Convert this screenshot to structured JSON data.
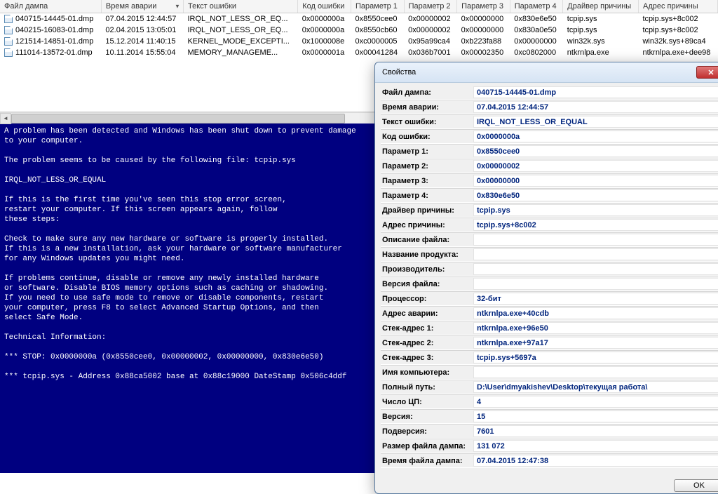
{
  "table": {
    "headers": [
      "Файл дампа",
      "Время аварии",
      "Текст ошибки",
      "Код ошибки",
      "Параметр 1",
      "Параметр 2",
      "Параметр 3",
      "Параметр 4",
      "Драйвер причины",
      "Адрес причины"
    ],
    "sort_col": 1,
    "rows": [
      {
        "file": "040715-14445-01.dmp",
        "time": "07.04.2015 12:44:57",
        "err": "IRQL_NOT_LESS_OR_EQ...",
        "code": "0x0000000a",
        "p1": "0x8550cee0",
        "p2": "0x00000002",
        "p3": "0x00000000",
        "p4": "0x830e6e50",
        "drv": "tcpip.sys",
        "addr": "tcpip.sys+8c002"
      },
      {
        "file": "040215-16083-01.dmp",
        "time": "02.04.2015 13:05:01",
        "err": "IRQL_NOT_LESS_OR_EQ...",
        "code": "0x0000000a",
        "p1": "0x8550cb60",
        "p2": "0x00000002",
        "p3": "0x00000000",
        "p4": "0x830a0e50",
        "drv": "tcpip.sys",
        "addr": "tcpip.sys+8c002"
      },
      {
        "file": "121514-14851-01.dmp",
        "time": "15.12.2014 11:40:15",
        "err": "KERNEL_MODE_EXCEPTI...",
        "code": "0x1000008e",
        "p1": "0xc0000005",
        "p2": "0x95a99ca4",
        "p3": "0xb223fa88",
        "p4": "0x00000000",
        "drv": "win32k.sys",
        "addr": "win32k.sys+89ca4"
      },
      {
        "file": "111014-13572-01.dmp",
        "time": "10.11.2014 15:55:04",
        "err": "MEMORY_MANAGEME...",
        "code": "0x0000001a",
        "p1": "0x00041284",
        "p2": "0x036b7001",
        "p3": "0x00002350",
        "p4": "0xc0802000",
        "drv": "ntkrnlpa.exe",
        "addr": "ntkrnlpa.exe+dee98"
      }
    ]
  },
  "bsod": "A problem has been detected and Windows has been shut down to prevent damage\nto your computer.\n\nThe problem seems to be caused by the following file: tcpip.sys\n\nIRQL_NOT_LESS_OR_EQUAL\n\nIf this is the first time you've seen this stop error screen,\nrestart your computer. If this screen appears again, follow\nthese steps:\n\nCheck to make sure any new hardware or software is properly installed.\nIf this is a new installation, ask your hardware or software manufacturer\nfor any Windows updates you might need.\n\nIf problems continue, disable or remove any newly installed hardware\nor software. Disable BIOS memory options such as caching or shadowing.\nIf you need to use safe mode to remove or disable components, restart\nyour computer, press F8 to select Advanced Startup Options, and then\nselect Safe Mode.\n\nTechnical Information:\n\n*** STOP: 0x0000000a (0x8550cee0, 0x00000002, 0x00000000, 0x830e6e50)\n\n*** tcpip.sys - Address 0x88ca5002 base at 0x88c19000 DateStamp 0x506c4ddf",
  "dialog": {
    "title": "Свойства",
    "rows": [
      {
        "label": "Файл дампа:",
        "value": "040715-14445-01.dmp"
      },
      {
        "label": "Время аварии:",
        "value": "07.04.2015 12:44:57"
      },
      {
        "label": "Текст ошибки:",
        "value": "IRQL_NOT_LESS_OR_EQUAL"
      },
      {
        "label": "Код ошибки:",
        "value": "0x0000000a"
      },
      {
        "label": "Параметр 1:",
        "value": "0x8550cee0"
      },
      {
        "label": "Параметр 2:",
        "value": "0x00000002"
      },
      {
        "label": "Параметр 3:",
        "value": "0x00000000"
      },
      {
        "label": "Параметр 4:",
        "value": "0x830e6e50"
      },
      {
        "label": "Драйвер причины:",
        "value": "tcpip.sys"
      },
      {
        "label": "Адрес причины:",
        "value": "tcpip.sys+8c002"
      },
      {
        "label": "Описание файла:",
        "value": ""
      },
      {
        "label": "Название продукта:",
        "value": ""
      },
      {
        "label": "Производитель:",
        "value": ""
      },
      {
        "label": "Версия файла:",
        "value": ""
      },
      {
        "label": "Процессор:",
        "value": "32-бит"
      },
      {
        "label": "Адрес аварии:",
        "value": "ntkrnlpa.exe+40cdb"
      },
      {
        "label": "Стек-адрес 1:",
        "value": "ntkrnlpa.exe+96e50"
      },
      {
        "label": "Стек-адрес 2:",
        "value": "ntkrnlpa.exe+97a17"
      },
      {
        "label": "Стек-адрес 3:",
        "value": "tcpip.sys+5697a"
      },
      {
        "label": "Имя компьютера:",
        "value": ""
      },
      {
        "label": "Полный путь:",
        "value": "D:\\User\\dmyakishev\\Desktop\\текущая работа\\"
      },
      {
        "label": "Число ЦП:",
        "value": "4"
      },
      {
        "label": "Версия:",
        "value": "15"
      },
      {
        "label": "Подверсия:",
        "value": "7601"
      },
      {
        "label": "Размер файла дампа:",
        "value": "131  072"
      },
      {
        "label": "Время файла дампа:",
        "value": "07.04.2015 12:47:38"
      }
    ],
    "ok": "OK"
  }
}
